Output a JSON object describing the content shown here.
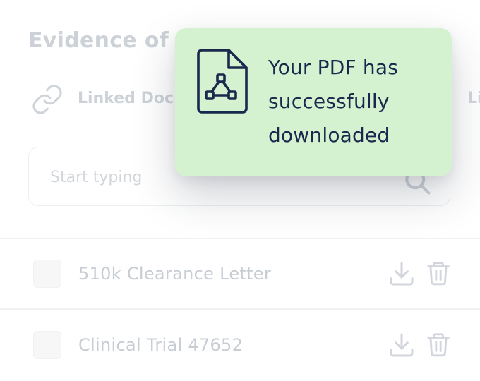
{
  "section": {
    "title": "Evidence of C"
  },
  "links": {
    "linked_label": "Linked Doc",
    "right_label": "Li"
  },
  "search": {
    "placeholder": "Start typing",
    "value": ""
  },
  "documents": [
    {
      "name": "510k Clearance Letter"
    },
    {
      "name": "Clinical Trial 47652"
    }
  ],
  "toast": {
    "message": "Your PDF has successfully downloaded",
    "icon": "pdf-file-icon",
    "background": "#d4f2cf",
    "text_color": "#18294d"
  },
  "icons": {
    "link": "link-icon",
    "search": "search-icon",
    "download": "download-icon",
    "delete": "trash-icon"
  }
}
